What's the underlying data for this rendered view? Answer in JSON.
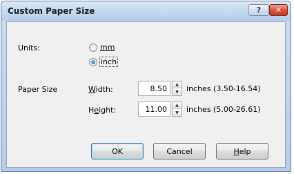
{
  "window": {
    "title": "Custom Paper Size",
    "help_glyph": "?",
    "close_glyph": "✕"
  },
  "units": {
    "label": "Units:",
    "options": [
      {
        "label": "mm",
        "selected": false
      },
      {
        "label": "inch",
        "selected": true
      }
    ]
  },
  "paper_size": {
    "label": "Paper Size",
    "width": {
      "label_pre": "",
      "label_key": "W",
      "label_post": "idth:",
      "value": "8.50",
      "range": "inches (3.50-16.54)"
    },
    "height": {
      "label_pre": "H",
      "label_key": "e",
      "label_post": "ight:",
      "value": "11.00",
      "range": "inches (5.00-26.61)"
    }
  },
  "buttons": {
    "ok": "OK",
    "cancel": "Cancel",
    "help_pre": "",
    "help_key": "H",
    "help_post": "elp"
  },
  "icons": {
    "help": "question-mark-icon",
    "close": "close-x-icon",
    "spin_up": "triangle-up-icon",
    "spin_down": "triangle-down-icon"
  }
}
